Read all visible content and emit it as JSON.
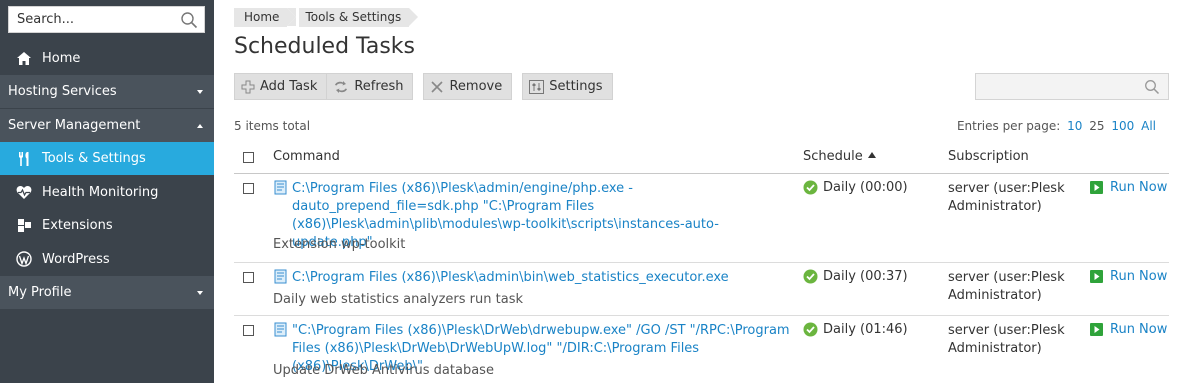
{
  "sidebar": {
    "search_placeholder": "Search...",
    "items": [
      {
        "label": "Home",
        "icon": "home-icon"
      },
      {
        "label": "Hosting Services",
        "type": "group",
        "state": "collapsed"
      },
      {
        "label": "Server Management",
        "type": "group",
        "state": "expanded"
      },
      {
        "label": "Tools & Settings",
        "icon": "tools-icon",
        "active": true
      },
      {
        "label": "Health Monitoring",
        "icon": "heart-pulse-icon"
      },
      {
        "label": "Extensions",
        "icon": "extensions-icon"
      },
      {
        "label": "WordPress",
        "icon": "wordpress-icon"
      },
      {
        "label": "My Profile",
        "type": "group",
        "state": "collapsed"
      }
    ]
  },
  "breadcrumb": [
    "Home",
    "Tools & Settings"
  ],
  "page_title": "Scheduled Tasks",
  "toolbar": {
    "add_task": "Add Task",
    "refresh": "Refresh",
    "remove": "Remove",
    "settings": "Settings"
  },
  "list": {
    "total_text": "5 items total",
    "entries_per_page_label": "Entries per page:",
    "page_sizes": [
      "10",
      "25",
      "100",
      "All"
    ],
    "current_page_size": "25"
  },
  "table": {
    "columns": {
      "command": "Command",
      "schedule": "Schedule",
      "subscription": "Subscription"
    },
    "sort": {
      "column": "schedule",
      "direction": "ascending"
    },
    "rows": [
      {
        "command": "C:\\Program Files (x86)\\Plesk\\admin/engine/php.exe -dauto_prepend_file=sdk.php \"C:\\Program Files (x86)\\Plesk\\admin\\plib\\modules\\wp-toolkit\\scripts\\instances-auto-update.php\"",
        "description": "Extension wp-toolkit",
        "schedule": "Daily (00:00)",
        "subscription": "server (user:Plesk Administrator)",
        "action": "Run Now"
      },
      {
        "command": "C:\\Program Files (x86)\\Plesk\\admin\\bin\\web_statistics_executor.exe",
        "description": "Daily web statistics analyzers run task",
        "schedule": "Daily (00:37)",
        "subscription": "server (user:Plesk Administrator)",
        "action": "Run Now"
      },
      {
        "command": "\"C:\\Program Files (x86)\\Plesk\\DrWeb\\drwebupw.exe\" /GO /ST \"/RPC:\\Program Files (x86)\\Plesk\\DrWeb\\DrWebUpW.log\" \"/DIR:C:\\Program Files (x86)\\Plesk\\DrWeb\\\"",
        "description": "Update DrWeb Antivirus database",
        "schedule": "Daily (01:46)",
        "subscription": "server (user:Plesk Administrator)",
        "action": "Run Now"
      }
    ]
  },
  "colors": {
    "sidebar_bg": "#3b434b",
    "sidebar_group_bg": "#4a535c",
    "active_accent": "#28aade",
    "link": "#1a83c6",
    "status_ok": "#6bb53f",
    "run_now": "#2fa33a"
  }
}
